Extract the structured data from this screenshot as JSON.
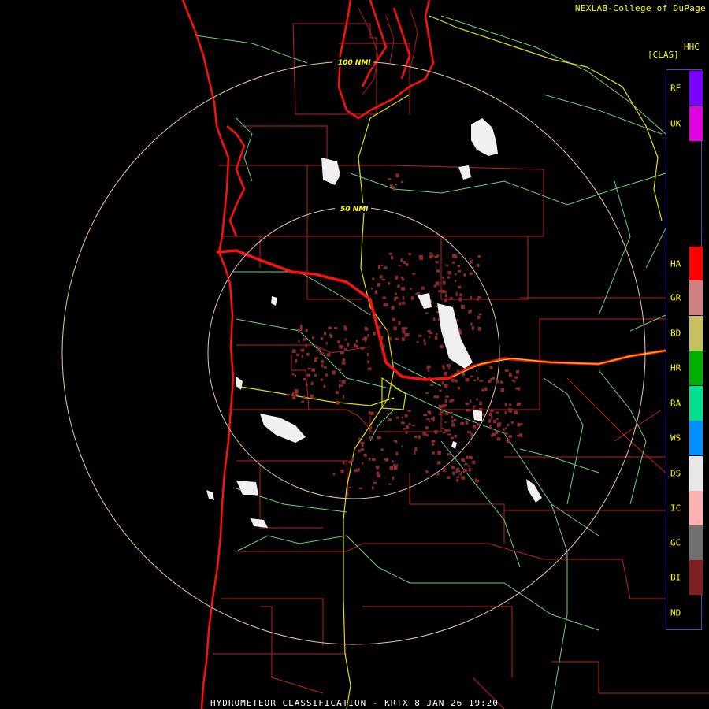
{
  "credit": "NEXLAB-College of DuPage",
  "product": {
    "code": "HHC",
    "mode": "[CLAS]"
  },
  "range_rings": [
    "100 NMI",
    "50 NMI"
  ],
  "legend": [
    {
      "code": "RF",
      "color": "#7a00ff"
    },
    {
      "code": "UK",
      "color": "#e000e0"
    },
    {
      "code": "HA",
      "color": "#ff0000"
    },
    {
      "code": "GR",
      "color": "#d08080"
    },
    {
      "code": "BD",
      "color": "#c8c060"
    },
    {
      "code": "HR",
      "color": "#00b000"
    },
    {
      "code": "RA",
      "color": "#00e090"
    },
    {
      "code": "WS",
      "color": "#0090ff"
    },
    {
      "code": "DS",
      "color": "#e8e8e8"
    },
    {
      "code": "IC",
      "color": "#ffb0b0"
    },
    {
      "code": "GC",
      "color": "#707070"
    },
    {
      "code": "BI",
      "color": "#802020"
    },
    {
      "code": "ND",
      "color": "#000000"
    }
  ],
  "footer": "HYDROMETEOR CLASSIFICATION - KRTX 8 JAN 26 19:20"
}
